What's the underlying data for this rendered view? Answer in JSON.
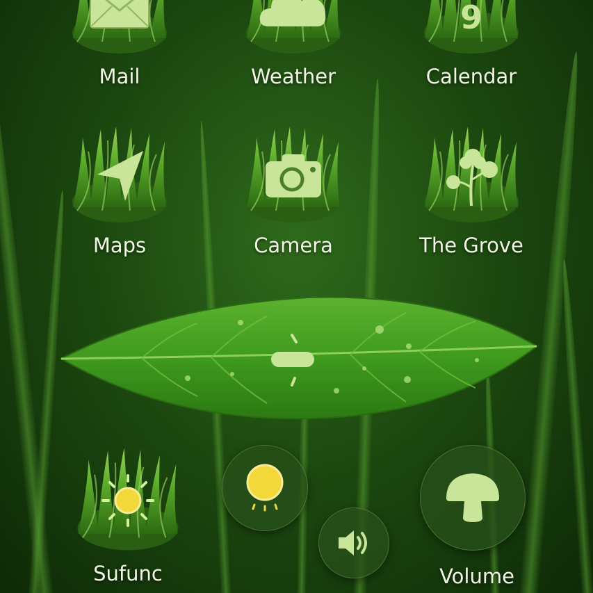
{
  "apps": {
    "row1": [
      {
        "label": "Mail",
        "icon": "envelope-icon"
      },
      {
        "label": "Weather",
        "icon": "cloud-icon"
      },
      {
        "label": "Calendar",
        "icon": "calendar-icon",
        "day": "9"
      }
    ],
    "row2": [
      {
        "label": "Maps",
        "icon": "arrow-pointer-icon"
      },
      {
        "label": "Camera",
        "icon": "camera-icon"
      },
      {
        "label": "The Grove",
        "icon": "herb-icon"
      }
    ],
    "row3": [
      {
        "label": "Sufunc",
        "icon": "sun-icon"
      },
      {
        "label": "Volume",
        "icon": "mushroom-icon"
      }
    ]
  },
  "controls": {
    "brightness_icon": "sun-dial-icon",
    "volume_icon": "speaker-icon"
  },
  "colors": {
    "accent_green": "#c8e59a",
    "label_text": "#f1f7e4",
    "sun_yellow": "#f3d83a",
    "leaf_green": "#3f9a1e"
  }
}
